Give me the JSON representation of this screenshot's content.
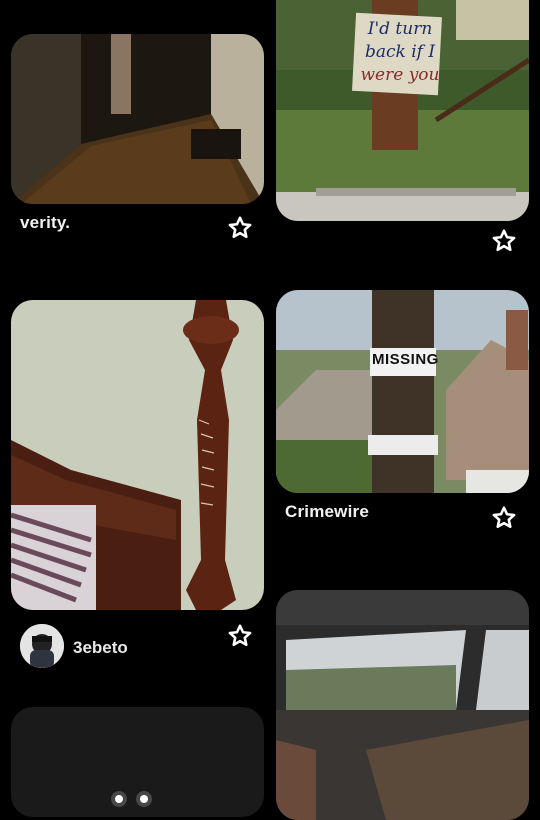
{
  "cards": [
    {
      "image": "dark-hallway-photo",
      "title": "verity."
    },
    {
      "image": "tree-sign-photo",
      "sign_text": [
        "I'd turn",
        "back if I",
        "were you"
      ]
    },
    {
      "image": "carved-bedpost-photo",
      "user": "3ebeto"
    },
    {
      "image": "missing-poster-pole-photo",
      "sign_text": [
        "MISSING"
      ],
      "title": "Crimewire"
    },
    {
      "image": "dark-night-lights-photo"
    },
    {
      "image": "car-interior-photo"
    }
  ],
  "icons": {
    "save": "star-outline-icon",
    "avatar": "user-avatar"
  }
}
